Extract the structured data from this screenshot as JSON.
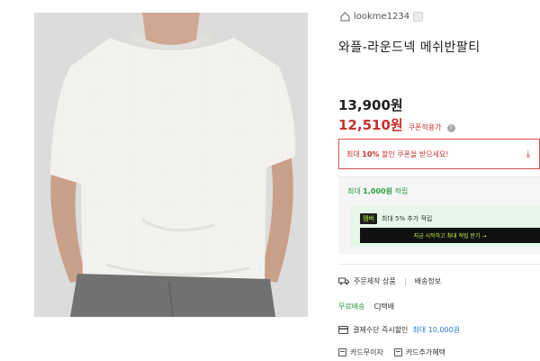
{
  "product": {
    "image_alt": "white waffle round-neck short-sleeve t-shirt on model",
    "seller": "lookme1234",
    "title": "와플-라운드넥 메쉬반팔티"
  },
  "pricing": {
    "original": "13,900원",
    "coupon_price": "12,510원",
    "coupon_label": "쿠폰적용가",
    "coupon_box_prefix": "최대",
    "coupon_box_rate": "10%",
    "coupon_box_suffix": "할인 쿠폰을 받으세요!"
  },
  "points": {
    "prefix": "최대",
    "amount": "1,000원",
    "suffix": "적립",
    "member_tag": "멤버",
    "member_text": "최대 5% 추가 적립",
    "member_cta": "지금 시작하고 최대 적립 받기 →"
  },
  "shipping": {
    "made_to_order": "주문제작 상품",
    "shipping_info": "배송정보",
    "free_delivery": "무료배송",
    "carrier": "CJ택배"
  },
  "payment": {
    "discount_text": "결제수단 즉시할인",
    "max_discount": "최대 10,000원",
    "tag_card_free": "카드무이자",
    "tag_card_extra": "카드추가혜택"
  },
  "colors": {
    "price_red": "#c9302c",
    "point_green": "#2e9d45",
    "member_lime": "#c6f542",
    "discount_blue": "#2e7bd6"
  }
}
